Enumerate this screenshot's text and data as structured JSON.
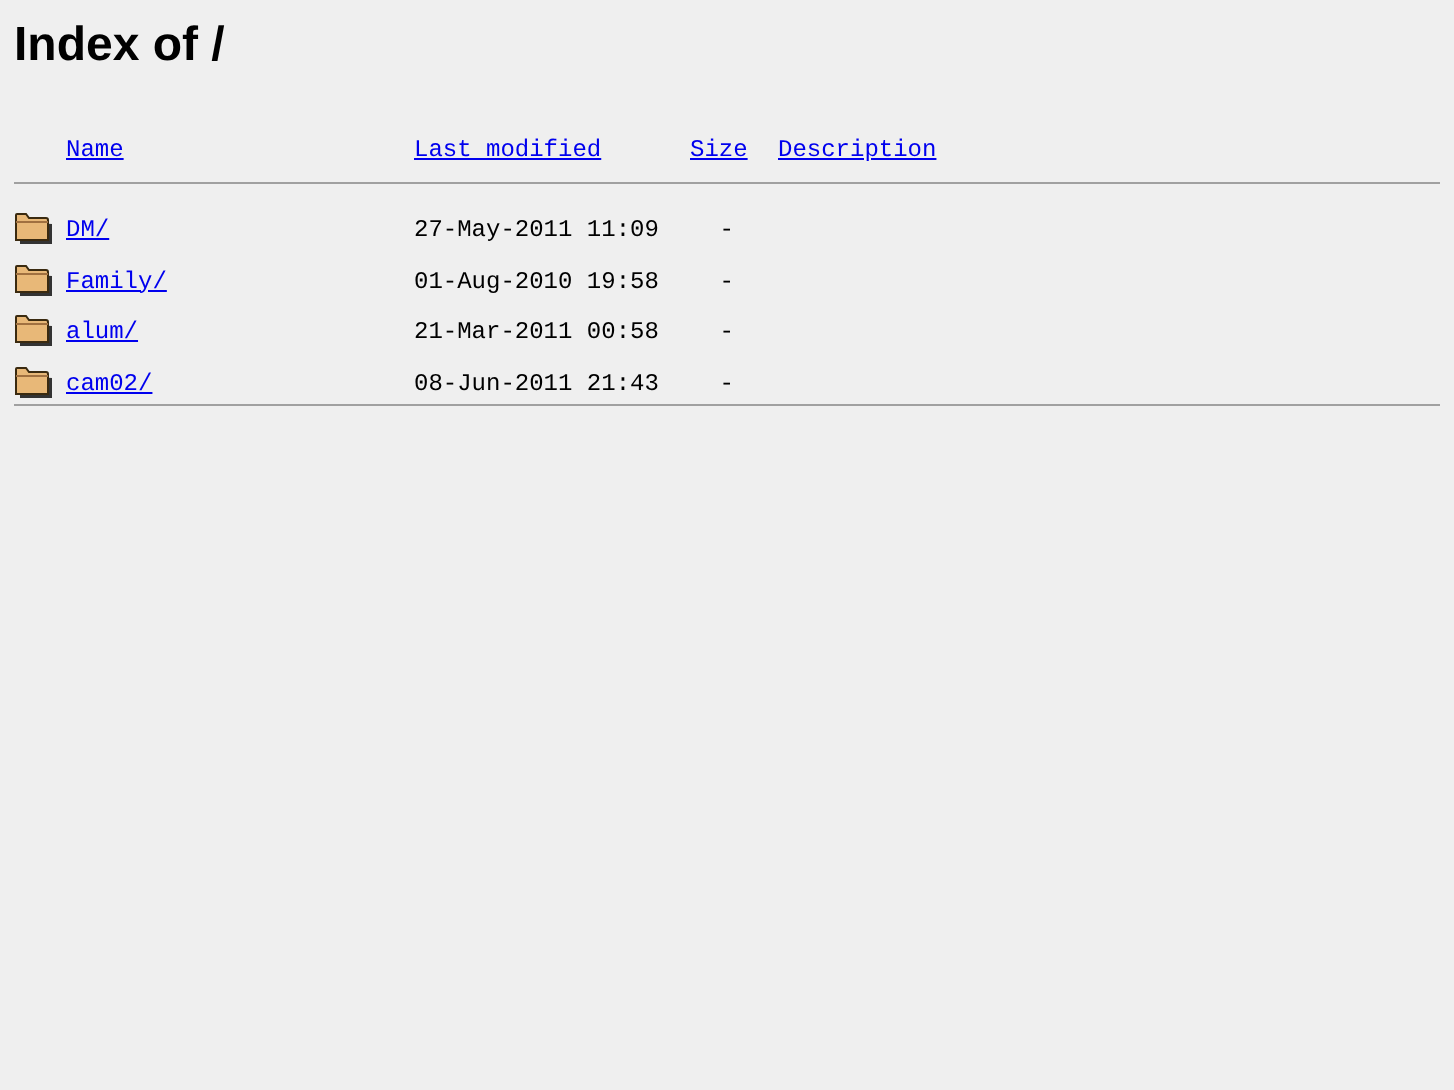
{
  "title": "Index of /",
  "columns": [
    "Name",
    "Last modified",
    "Size",
    "Description"
  ],
  "rows": [
    {
      "name": "DM/",
      "last_modified": "27-May-2011 11:09",
      "size": "-"
    },
    {
      "name": "Family/",
      "last_modified": "01-Aug-2010 19:58",
      "size": "-"
    },
    {
      "name": "alum/",
      "last_modified": "21-Mar-2011 00:58",
      "size": "-"
    },
    {
      "name": "cam02/",
      "last_modified": "08-Jun-2011 21:43",
      "size": "-"
    }
  ]
}
